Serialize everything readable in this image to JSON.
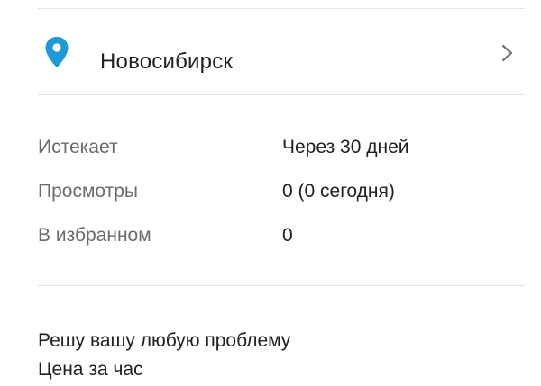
{
  "location": {
    "city": "Новосибирск",
    "icon": "map-pin-icon",
    "accent_color": "#1e9ad6"
  },
  "stats": [
    {
      "label": "Истекает",
      "value": "Через 30 дней"
    },
    {
      "label": "Просмотры",
      "value": "0 (0 сегодня)"
    },
    {
      "label": "В избранном",
      "value": "0"
    }
  ],
  "description": {
    "line1": "Решу вашу любую проблему",
    "line2": "Цена за час"
  }
}
